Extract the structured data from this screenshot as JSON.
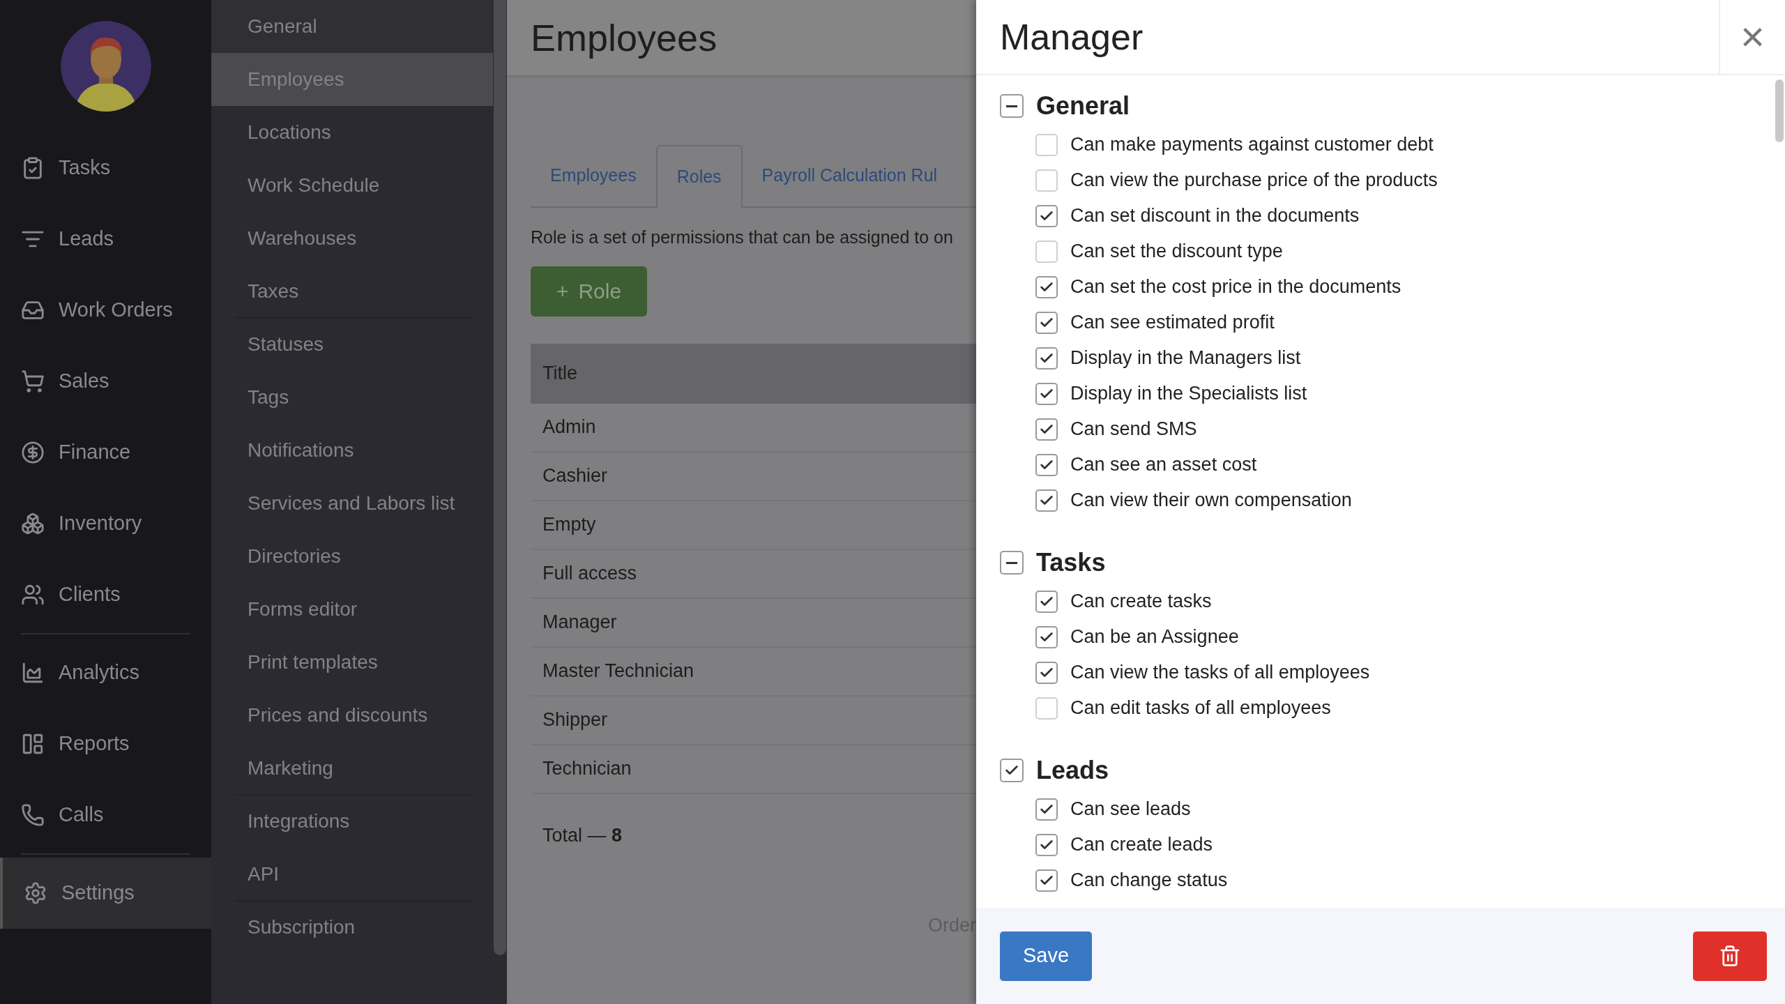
{
  "main_nav": {
    "items": [
      {
        "label": "Tasks",
        "selected": false
      },
      {
        "label": "Leads",
        "selected": false
      },
      {
        "label": "Work Orders",
        "selected": false
      },
      {
        "label": "Sales",
        "selected": false
      },
      {
        "label": "Finance",
        "selected": false
      },
      {
        "label": "Inventory",
        "selected": false
      },
      {
        "label": "Clients",
        "selected": false,
        "divider_after": true
      },
      {
        "label": "Analytics",
        "selected": false
      },
      {
        "label": "Reports",
        "selected": false
      },
      {
        "label": "Calls",
        "selected": false,
        "divider_after": true
      },
      {
        "label": "Settings",
        "selected": true
      }
    ]
  },
  "settings_menu": {
    "items": [
      {
        "label": "General",
        "selected": false
      },
      {
        "label": "Employees",
        "selected": true
      },
      {
        "label": "Locations",
        "selected": false
      },
      {
        "label": "Work Schedule",
        "selected": false
      },
      {
        "label": "Warehouses",
        "selected": false
      },
      {
        "label": "Taxes",
        "selected": false,
        "divider_after": true
      },
      {
        "label": "Statuses",
        "selected": false
      },
      {
        "label": "Tags",
        "selected": false
      },
      {
        "label": "Notifications",
        "selected": false
      },
      {
        "label": "Services and Labors list",
        "selected": false
      },
      {
        "label": "Directories",
        "selected": false
      },
      {
        "label": "Forms editor",
        "selected": false
      },
      {
        "label": "Print templates",
        "selected": false
      },
      {
        "label": "Prices and discounts",
        "selected": false
      },
      {
        "label": "Marketing",
        "selected": false,
        "divider_after": true
      },
      {
        "label": "Integrations",
        "selected": false
      },
      {
        "label": "API",
        "selected": false,
        "divider_after": true
      },
      {
        "label": "Subscription",
        "selected": false
      }
    ]
  },
  "page": {
    "title": "Employees",
    "tabs": [
      {
        "label": "Employees",
        "selected": false
      },
      {
        "label": "Roles",
        "selected": true
      },
      {
        "label": "Payroll Calculation Rul",
        "selected": false
      }
    ],
    "description": "Role is a set of permissions that can be assigned to on",
    "add_button": {
      "icon": "+",
      "label": "Role"
    },
    "table": {
      "columns": [
        "Title"
      ],
      "rows": [
        "Admin",
        "Cashier",
        "Empty",
        "Full access",
        "Manager",
        "Master Technician",
        "Shipper",
        "Technician"
      ]
    },
    "total": "Total — **8**",
    "footer_text": "Order"
  },
  "drawer": {
    "title": "Manager",
    "close": "×",
    "groups": [
      {
        "title": "General",
        "indeterminate": true,
        "items": [
          {
            "label": "Can make payments against customer debt",
            "checked": false
          },
          {
            "label": "Can view the purchase price of the products",
            "checked": false
          },
          {
            "label": "Can set discount in the documents",
            "checked": true
          },
          {
            "label": "Can set the discount type",
            "checked": false
          },
          {
            "label": "Can set the cost price in the documents",
            "checked": true
          },
          {
            "label": "Can see estimated profit",
            "checked": true
          },
          {
            "label": "Display in the Managers list",
            "checked": true
          },
          {
            "label": "Display in the Specialists list",
            "checked": true
          },
          {
            "label": "Can send SMS",
            "checked": true
          },
          {
            "label": "Can see an asset cost",
            "checked": true
          },
          {
            "label": "Can view their own compensation",
            "checked": true
          }
        ]
      },
      {
        "title": "Tasks",
        "indeterminate": true,
        "items": [
          {
            "label": "Can create tasks",
            "checked": true
          },
          {
            "label": "Can be an Assignee",
            "checked": true
          },
          {
            "label": "Can view the tasks of all employees",
            "checked": true
          },
          {
            "label": "Can edit tasks of all employees",
            "checked": false
          }
        ]
      },
      {
        "title": "Leads",
        "checked": true,
        "items": [
          {
            "label": "Can see leads",
            "checked": true
          },
          {
            "label": "Can create leads",
            "checked": true
          },
          {
            "label": "Can change status",
            "checked": true
          }
        ]
      }
    ],
    "save_button": "Save"
  }
}
